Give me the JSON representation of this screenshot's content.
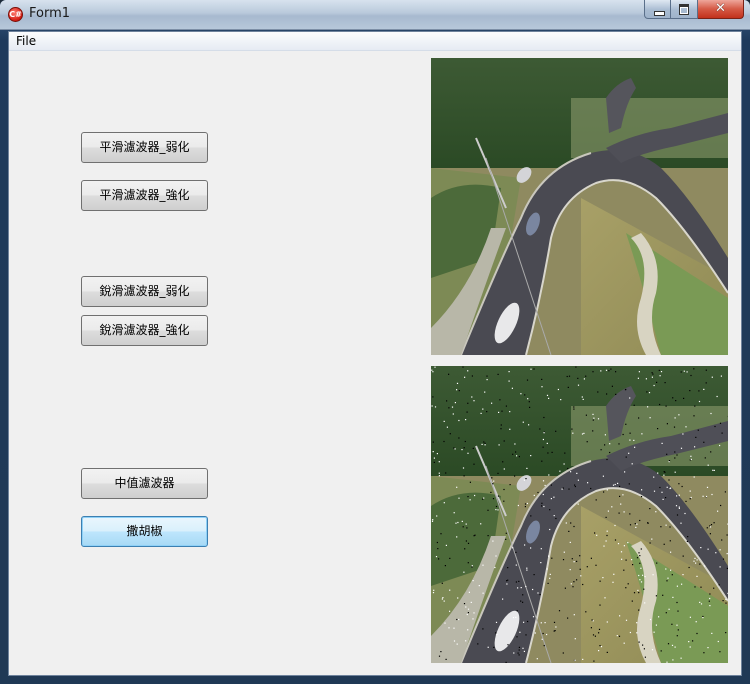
{
  "window": {
    "title": "Form1",
    "icon": "csharp-app-icon",
    "controls": [
      "minimize-icon",
      "maximize-icon",
      "close-icon"
    ]
  },
  "menu": {
    "items": [
      {
        "label": "File"
      }
    ]
  },
  "buttons": {
    "smooth_weak": "平滑濾波器_弱化",
    "smooth_strong": "平滑濾波器_強化",
    "sharpen_weak": "銳滑濾波器_弱化",
    "sharpen_strong": "銳滑濾波器_強化",
    "median": "中值濾波器",
    "salt_pepper": "撒胡椒"
  },
  "images": {
    "original": "aerial-road-photo",
    "noisy": "aerial-road-photo-salt-pepper"
  },
  "colors": {
    "client_bg": "#f0f0f0",
    "focus_border": "#3c7fb1",
    "titlebar": "#b9c9db"
  }
}
